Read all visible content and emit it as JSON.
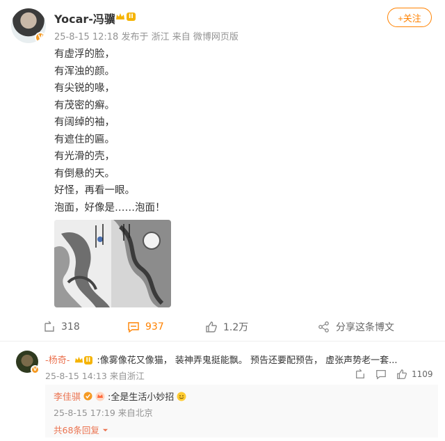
{
  "post": {
    "author": "Yocar-冯骥",
    "level": "II",
    "meta": "25-8-15 12:18  发布于 浙江  来自 微博网页版",
    "follow_label": "+关注",
    "lines": [
      "有虚浮的脸，",
      "有浑浊的颜。",
      "有尖锐的喙，",
      "有茂密的癣。",
      "有阔绰的袖，",
      "有遮住的匾。",
      "有光滑的壳，",
      "有倒悬的天。",
      "好怪，再看一眼。",
      "泡面，好像是……泡面！"
    ],
    "repost_count": "318",
    "comment_count": "937",
    "like_count": "1.2万",
    "share_label": "分享这条博文"
  },
  "comment": {
    "author": "-杨奇-",
    "level": "II",
    "text": ":像雾像花又像猫， 装神弄鬼挺能飘。 预告还要配预告， 虚张声势老一套...",
    "meta": "25-8-15 14:13 来自浙江",
    "like_count": "1109"
  },
  "reply": {
    "author": "李佳骐",
    "text": ":全是生活小妙招",
    "meta": "25-8-15 17:19 来自北京",
    "more_label": "共68条回复"
  },
  "colors": {
    "accent": "#ff8200",
    "name_link": "#eb7350",
    "muted": "#939393"
  }
}
